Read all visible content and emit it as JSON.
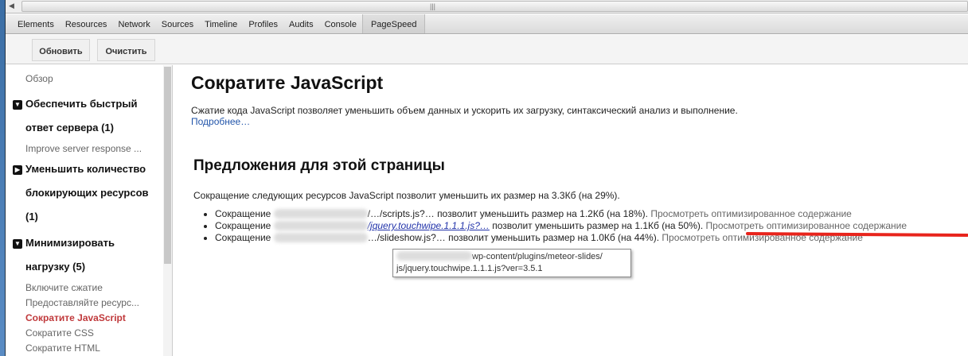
{
  "tabs": [
    "Elements",
    "Resources",
    "Network",
    "Sources",
    "Timeline",
    "Profiles",
    "Audits",
    "Console",
    "PageSpeed"
  ],
  "toolbar": {
    "refresh": "Обновить",
    "clear": "Очистить"
  },
  "sidebar": {
    "overview": "Обзор",
    "group1": {
      "line1": "Обеспечить быстрый",
      "line2": "ответ сервера (1)",
      "items": [
        "Improve server response ..."
      ]
    },
    "group2": {
      "line1": "Уменьшить количество",
      "line2": "блокирующих ресурсов",
      "line3": "(1)"
    },
    "group3": {
      "line1": "Минимизировать",
      "line2": "нагрузку (5)",
      "items": [
        "Включите сжатие",
        "Предоставляйте ресурс...",
        "Сократите JavaScript",
        "Сократите CSS",
        "Сократите HTML"
      ]
    }
  },
  "main": {
    "title": "Сократите JavaScript",
    "description": "Сжатие кода JavaScript позволяет уменьшить объем данных и ускорить их загрузку, синтаксический анализ и выполнение.",
    "more": "Подробнее…",
    "subtitle": "Предложения для этой страницы",
    "summary": "Сокращение следующих ресурсов JavaScript позволит уменьшить их размер на 3.3Кб (на 29%).",
    "items": [
      {
        "prefix": "Сокращение",
        "file": "/…/scripts.js?…",
        "text": "позволит уменьшить размер на 1.2Кб (на 18%).",
        "action": "Просмотреть оптимизированное содержание"
      },
      {
        "prefix": "Сокращение",
        "file": "/jquery.touchwipe.1.1.1.js?…",
        "text": "позволит уменьшить размер на 1.1Кб (на 50%).",
        "action": "Просмотреть оптимизированное содержание"
      },
      {
        "prefix": "Сокращение",
        "file": "…/slideshow.js?…",
        "text": "позволит уменьшить размер на 1.0Кб (на 44%).",
        "action": "Просмотреть оптимизированное содержание"
      }
    ],
    "tooltip": {
      "line1": "wp-content/plugins/meteor-slides/",
      "line2": "js/jquery.touchwipe.1.1.1.js?ver=3.5.1"
    }
  }
}
